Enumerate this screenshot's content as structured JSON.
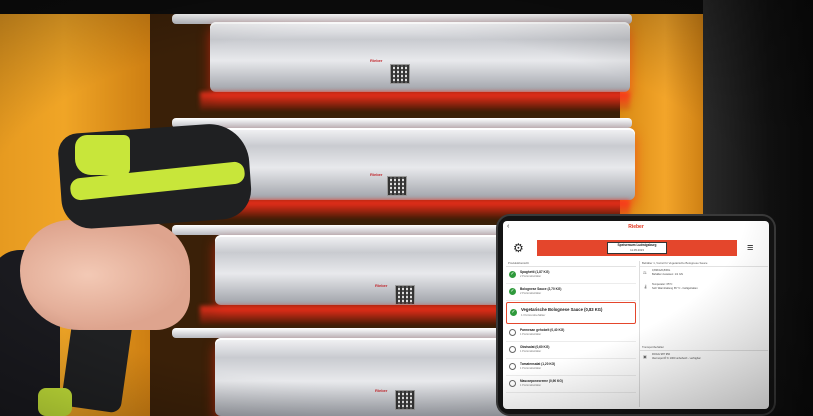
{
  "tray_labels": [
    "Rieber",
    "Rieber",
    "Rieber",
    "Rieber"
  ],
  "app": {
    "brand": "Rieber",
    "back_icon": "chevron-left-icon",
    "settings_icon": "gear-icon",
    "list_icon": "checklist-icon",
    "banner_title": "Speiseraum Ludwigsburg",
    "banner_date": "11.05.2023",
    "accent_color": "#e4462c",
    "left_header": "Produktübersicht",
    "items": [
      {
        "name": "Spaghetti (1,87 KG)",
        "sub": "2 Portionsbehälter",
        "status": "done"
      },
      {
        "name": "Bolognese Sauce (2,70 KG)",
        "sub": "2 Portionsbehälter",
        "status": "done"
      },
      {
        "name": "Vegetarische Bolognese Sauce (0,83 KG)",
        "sub": "1 Portionsbehälter",
        "status": "done"
      },
      {
        "name": "Parmesan gehobelt (0,40 KG)",
        "sub": "1 Portionsbehälter",
        "status": "open"
      },
      {
        "name": "Obstsalat (0,60 KG)",
        "sub": "1 Portionsbehälter",
        "status": "open"
      },
      {
        "name": "Tomatensalat (1,20 KG)",
        "sub": "1 Portionsbehälter",
        "status": "open"
      },
      {
        "name": "Mascarponecreme (0,90 KG)",
        "sub": "1 Portionsbehälter",
        "status": "open"
      }
    ],
    "right_header": "Behälter 1, Vorrat für Vegetarische Bolognese Sauce",
    "details": [
      {
        "icon": "scale-icon",
        "line1": "0,83KG/0,83KG",
        "line2": "Behälter zuweisen: 1/1 GN"
      },
      {
        "icon": "thermometer-icon",
        "line1": "Temperatur: 65°C",
        "line2": "Soll: Warmhaltung 65 °C - heißgehalten"
      }
    ],
    "section2_header": "Transportbehälter",
    "section2_detail": {
      "icon": "box-icon",
      "line1": "ROGG 987 950",
      "line2": "thermoport® K 1000 unbeheizt - verfügbar"
    }
  }
}
